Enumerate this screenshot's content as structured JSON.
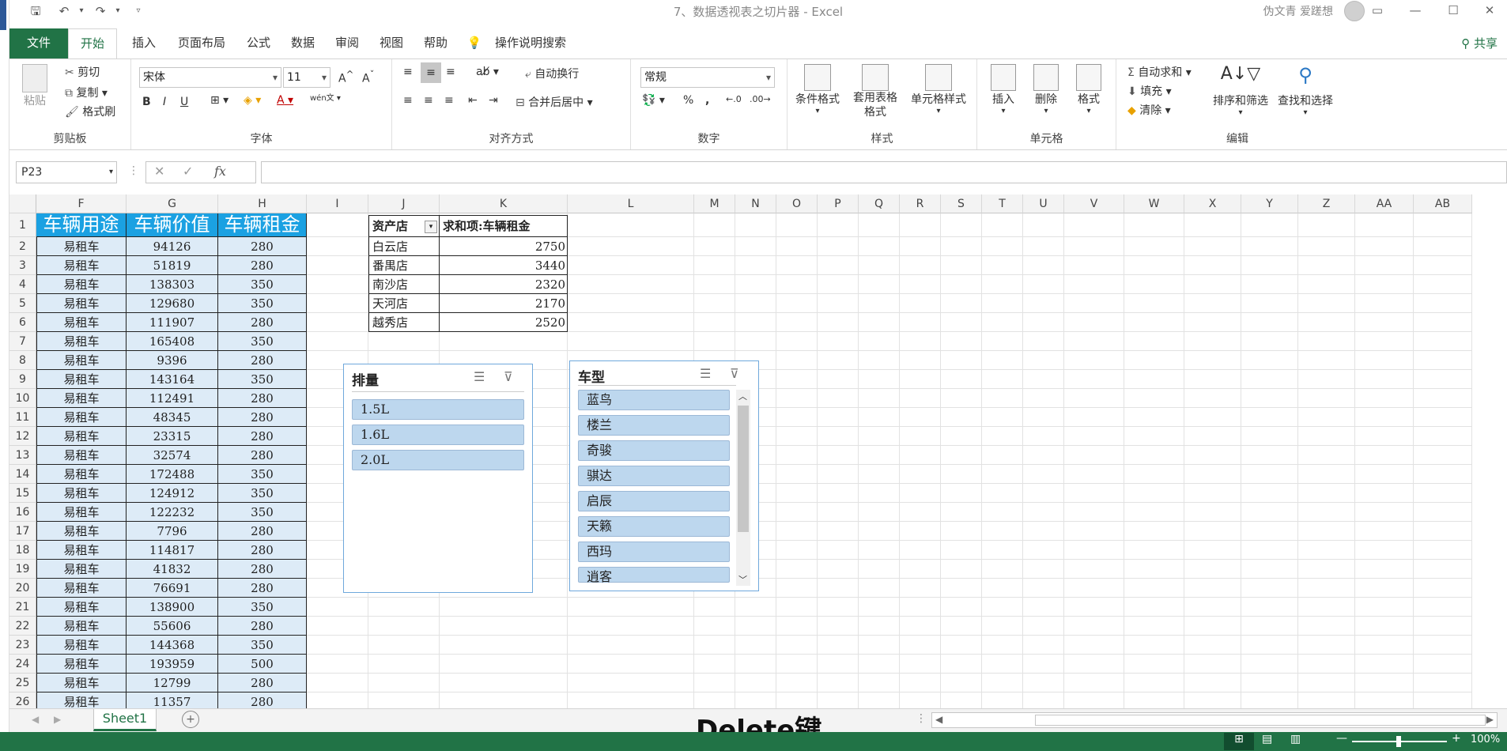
{
  "title_bar": {
    "window_title": "7、数据透视表之切片器  -  Excel",
    "user": "伪文青 爱蹉想"
  },
  "tabs": [
    "开始",
    "插入",
    "页面布局",
    "公式",
    "数据",
    "审阅",
    "视图",
    "帮助"
  ],
  "file_tab": "文件",
  "tell_me": "操作说明搜索",
  "share": "共享",
  "ribbon": {
    "clipboard": {
      "paste": "粘贴",
      "cut": "剪切",
      "copy": "复制",
      "format_painter": "格式刷",
      "label": "剪贴板"
    },
    "font": {
      "name": "宋体",
      "size": "11",
      "label": "字体",
      "bold": "B",
      "italic": "I",
      "underline": "U",
      "font_color_glyph": "A",
      "wen": "wén文"
    },
    "alignment": {
      "wrap": "自动换行",
      "merge": "合并后居中",
      "label": "对齐方式"
    },
    "number": {
      "format": "常规",
      "percent": "%",
      "comma": ",",
      "label": "数字"
    },
    "styles": {
      "conditional": "条件格式",
      "table_format": "套用表格格式",
      "cell_styles": "单元格样式",
      "label": "样式"
    },
    "cells": {
      "insert": "插入",
      "delete": "删除",
      "format": "格式",
      "label": "单元格"
    },
    "editing": {
      "autosum": "自动求和",
      "fill": "填充",
      "clear": "清除",
      "sort_filter": "排序和筛选",
      "find_select": "查找和选择",
      "label": "编辑"
    }
  },
  "formula_bar": {
    "name_box": "P23",
    "fx": "fx",
    "formula": ""
  },
  "columns": [
    "F",
    "G",
    "H",
    "I",
    "J",
    "K",
    "L",
    "M",
    "N",
    "O",
    "P",
    "Q",
    "R",
    "S",
    "T",
    "U",
    "V",
    "W",
    "X",
    "Y",
    "Z",
    "AA",
    "AB"
  ],
  "rows": [
    "1",
    "2",
    "3",
    "4",
    "5",
    "6",
    "7",
    "8",
    "9",
    "10",
    "11",
    "12",
    "13",
    "14",
    "15",
    "16",
    "17",
    "18",
    "19",
    "20",
    "21",
    "22",
    "23",
    "24",
    "25",
    "26"
  ],
  "data_table": {
    "headers": [
      "车辆用途",
      "车辆价值",
      "车辆租金"
    ],
    "rows": [
      [
        "易租车",
        "94126",
        "280"
      ],
      [
        "易租车",
        "51819",
        "280"
      ],
      [
        "易租车",
        "138303",
        "350"
      ],
      [
        "易租车",
        "129680",
        "350"
      ],
      [
        "易租车",
        "111907",
        "280"
      ],
      [
        "易租车",
        "165408",
        "350"
      ],
      [
        "易租车",
        "9396",
        "280"
      ],
      [
        "易租车",
        "143164",
        "350"
      ],
      [
        "易租车",
        "112491",
        "280"
      ],
      [
        "易租车",
        "48345",
        "280"
      ],
      [
        "易租车",
        "23315",
        "280"
      ],
      [
        "易租车",
        "32574",
        "280"
      ],
      [
        "易租车",
        "172488",
        "350"
      ],
      [
        "易租车",
        "124912",
        "350"
      ],
      [
        "易租车",
        "122232",
        "350"
      ],
      [
        "易租车",
        "7796",
        "280"
      ],
      [
        "易租车",
        "114817",
        "280"
      ],
      [
        "易租车",
        "41832",
        "280"
      ],
      [
        "易租车",
        "76691",
        "280"
      ],
      [
        "易租车",
        "138900",
        "350"
      ],
      [
        "易租车",
        "55606",
        "280"
      ],
      [
        "易租车",
        "144368",
        "350"
      ],
      [
        "易租车",
        "193959",
        "500"
      ],
      [
        "易租车",
        "12799",
        "280"
      ],
      [
        "易租车",
        "11357",
        "280"
      ]
    ]
  },
  "pivot": {
    "headers": [
      "资产店",
      "求和项:车辆租金"
    ],
    "rows": [
      [
        "白云店",
        "2750"
      ],
      [
        "番禺店",
        "3440"
      ],
      [
        "南沙店",
        "2320"
      ],
      [
        "天河店",
        "2170"
      ],
      [
        "越秀店",
        "2520"
      ]
    ]
  },
  "slicer_displacement": {
    "title": "排量",
    "items": [
      "1.5L",
      "1.6L",
      "2.0L"
    ]
  },
  "slicer_model": {
    "title": "车型",
    "items": [
      "蓝鸟",
      "楼兰",
      "奇骏",
      "骐达",
      "启辰",
      "天籁",
      "西玛",
      "逍客"
    ]
  },
  "sheet_tab": "Sheet1",
  "overlay": "Delete键",
  "zoom": "100%",
  "colors": {
    "excel_green": "#217346",
    "header_blue": "#1ba1e2",
    "band_blue": "#ddebf7",
    "slicer_blue": "#bdd7ee"
  }
}
